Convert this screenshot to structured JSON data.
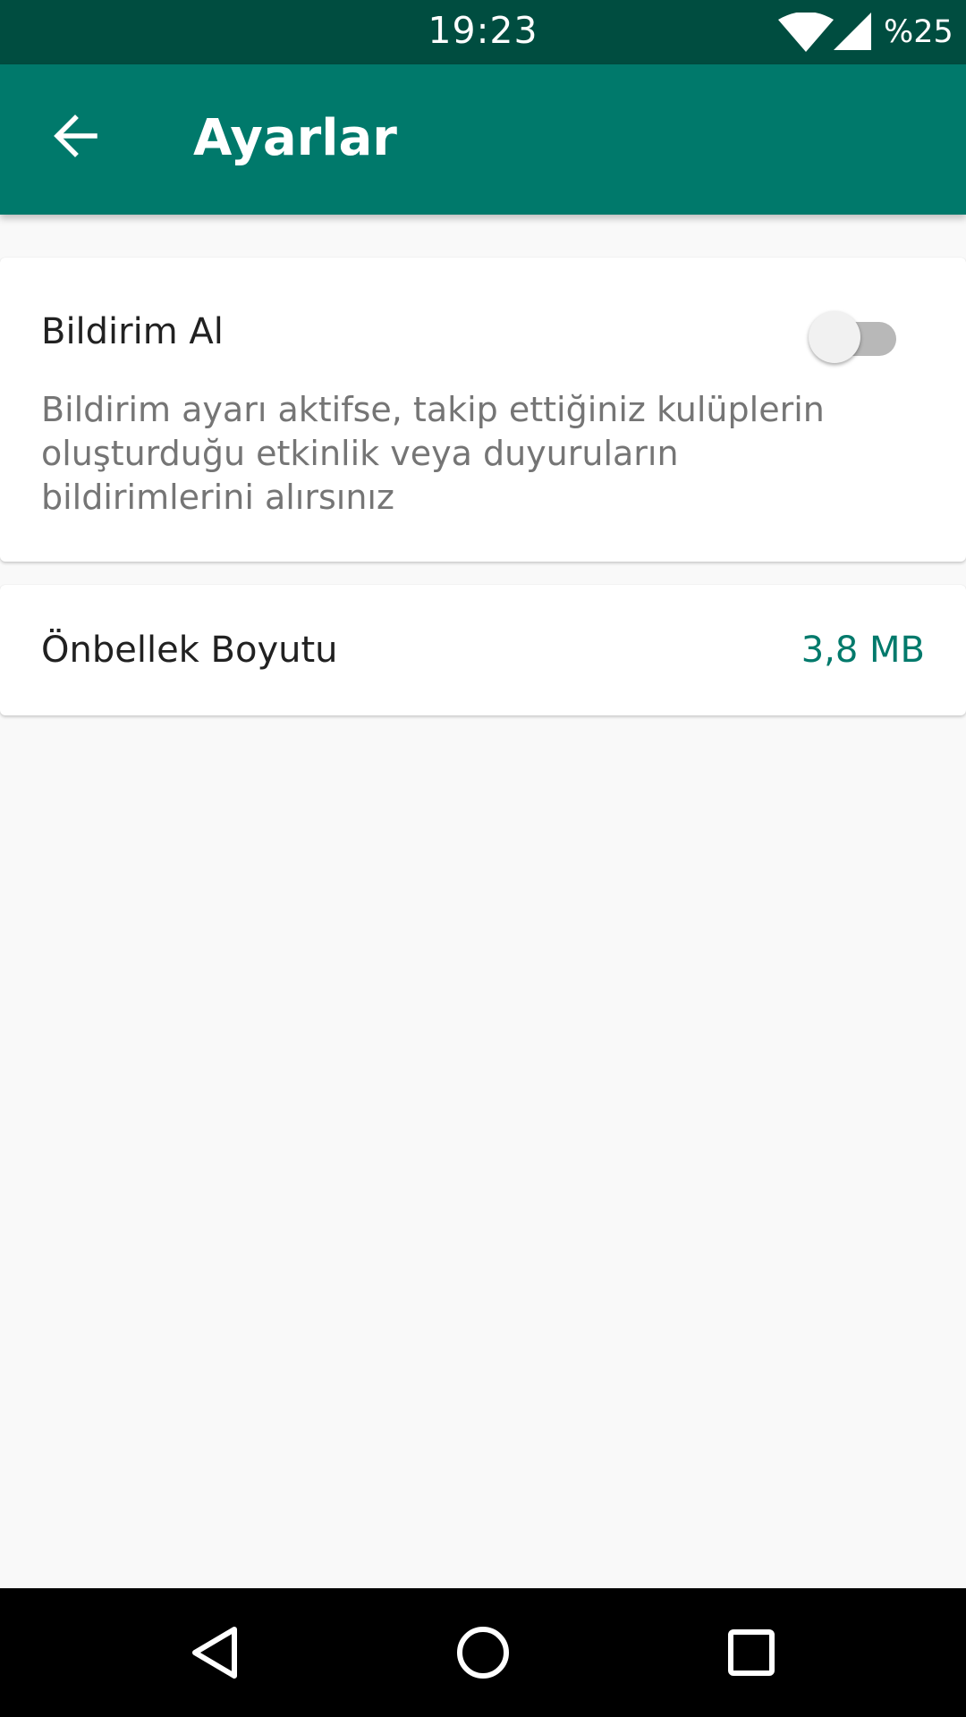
{
  "status_bar": {
    "time": "19:23",
    "battery": "%25",
    "icons": [
      "wifi-icon",
      "signal-icon"
    ]
  },
  "app_bar": {
    "title": "Ayarlar",
    "back_icon": "arrow-back-icon"
  },
  "settings": {
    "notifications": {
      "title": "Bildirim Al",
      "description": "Bildirim ayarı aktifse, takip ettiğiniz kulüplerin oluşturduğu etkinlik veya duyuruların bildirimlerini alırsınız",
      "enabled": false
    },
    "cache": {
      "label": "Önbellek Boyutu",
      "value": "3,8 MB"
    }
  },
  "nav_bar": {
    "icons": [
      "nav-back-icon",
      "nav-home-icon",
      "nav-recent-icon"
    ]
  },
  "colors": {
    "status_bar": "#004d40",
    "app_bar": "#00796b",
    "accent": "#00796b",
    "background": "#f9f9f9",
    "toggle_off_track": "#b8b8b8",
    "toggle_off_thumb": "#f1f1f1"
  }
}
